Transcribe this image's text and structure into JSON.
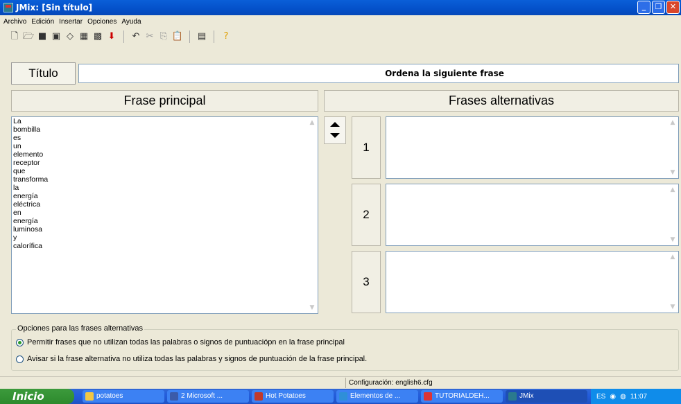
{
  "window": {
    "title": "JMix: [Sin título]"
  },
  "menu": [
    "Archivo",
    "Edición",
    "Insertar",
    "Opciones",
    "Ayuda"
  ],
  "toolbar": {
    "icons": [
      "new-file-icon",
      "open-folder-icon",
      "save-icon",
      "save-as-icon",
      "eraser-icon",
      "create-web-page-icon",
      "create-web-page-2-icon",
      "export-arrow-icon",
      "undo-icon",
      "cut-icon",
      "copy-icon",
      "paste-icon",
      "config-icon",
      "help-icon"
    ]
  },
  "titulo": {
    "label": "Título",
    "value": "Ordena la siguiente frase"
  },
  "main_header": "Frase principal",
  "alt_header": "Frases alternativas",
  "main_words": [
    "La",
    "bombilla",
    "es",
    "un",
    "elemento",
    "receptor",
    "que",
    "transforma",
    "la",
    "energía",
    "eléctrica",
    "en",
    "energía",
    "luminosa",
    "y",
    "calorífica"
  ],
  "alternatives": [
    {
      "number": "1",
      "text": ""
    },
    {
      "number": "2",
      "text": ""
    },
    {
      "number": "3",
      "text": ""
    }
  ],
  "options": {
    "legend": "Opciones para las frases alternativas",
    "option1": "Permitir frases que no utilizan todas las palabras o signos de puntuaciópn en la frase principal",
    "option2": "Avisar si la frase alternativa no utiliza todas las palabras y signos de puntuación de la frase principal.",
    "selected": 1
  },
  "status": {
    "config": "Configuración: english6.cfg"
  },
  "taskbar": {
    "start": "Inicio",
    "tasks": [
      {
        "label": "potatoes",
        "color": "#f2c744"
      },
      {
        "label": "2 Microsoft ...",
        "color": "#3b5ba9"
      },
      {
        "label": "Hot Potatoes",
        "color": "#c0392b"
      },
      {
        "label": "Elementos de ...",
        "color": "#2f8fd8"
      },
      {
        "label": "TUTORIALDEH...",
        "color": "#d33"
      },
      {
        "label": "JMix",
        "color": "#2a7a8e"
      }
    ],
    "lang": "ES",
    "time": "11:07"
  }
}
